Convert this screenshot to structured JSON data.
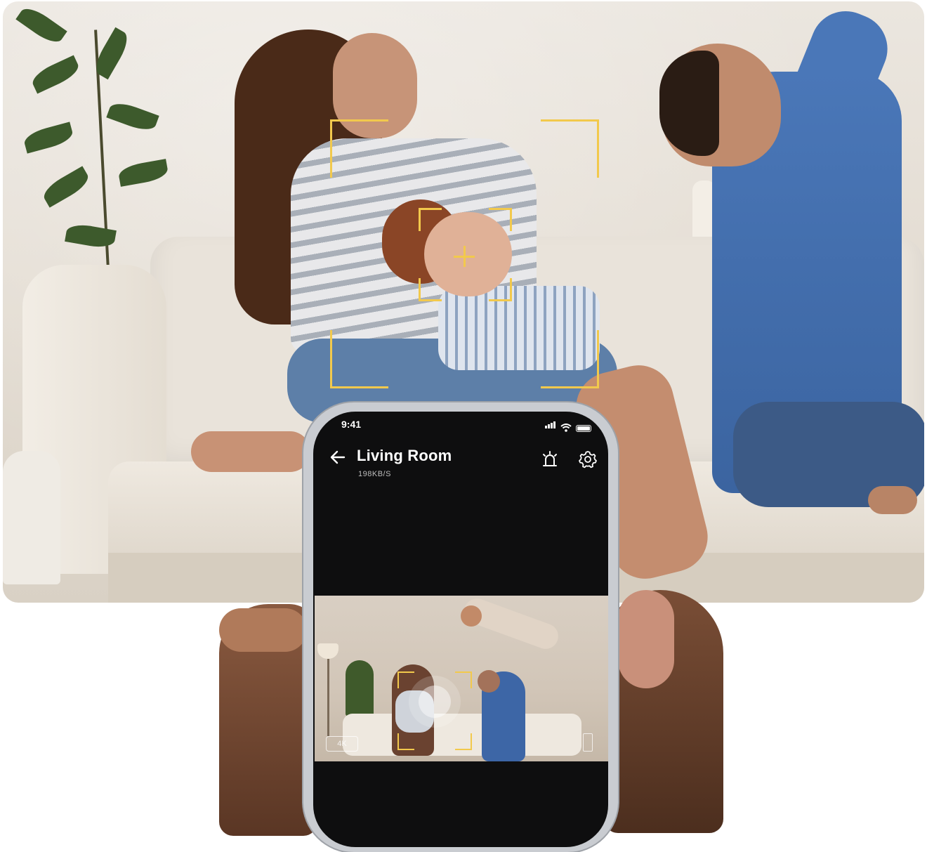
{
  "phone": {
    "status": {
      "time": "9:41"
    },
    "header": {
      "title": "Living Room",
      "subtitle": "198KB/S"
    },
    "icons": {
      "back": "arrow-left-icon",
      "alarm": "siren-icon",
      "settings": "gear-icon"
    },
    "video": {
      "badge": "4K"
    }
  },
  "colors": {
    "focus_frame": "#f2c94c",
    "screen_background": "#0e0e0f"
  }
}
